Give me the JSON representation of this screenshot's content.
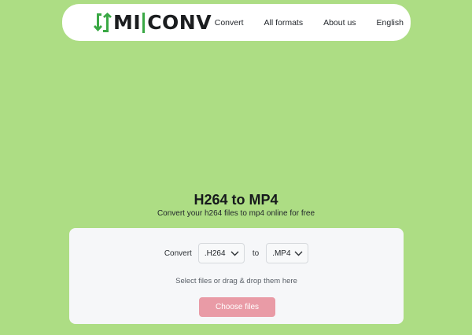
{
  "brand": {
    "logo_text": "CONV",
    "logo_prefix": "MI",
    "colors": {
      "green": "#3aa845",
      "dark": "#1b1d1f"
    }
  },
  "nav": {
    "links": [
      "Convert",
      "All formats",
      "About us",
      "English"
    ]
  },
  "hero": {
    "title": "H264 to MP4",
    "subtitle": "Convert your h264 files to mp4 online for free"
  },
  "converter": {
    "convert_label": "Convert",
    "from_value": ".H264",
    "to_label": "to",
    "to_value": ".MP4",
    "hint": "Select files or drag & drop them here",
    "button_label": "Choose files",
    "button_color": "#e99ba6"
  },
  "page": {
    "background": "#addd84"
  }
}
